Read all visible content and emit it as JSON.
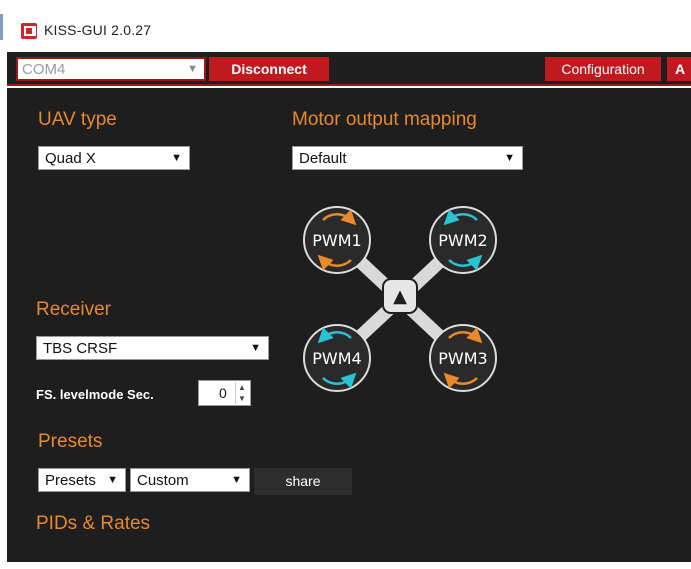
{
  "window": {
    "title": "KISS-GUI 2.0.27"
  },
  "toolbar": {
    "port": "COM4",
    "port_arrow": "▼",
    "disconnect_label": "Disconnect",
    "configuration_label": "Configuration",
    "more_tab_label": "A"
  },
  "uav": {
    "heading": "UAV type",
    "value": "Quad X"
  },
  "motor": {
    "heading": "Motor output mapping",
    "value": "Default",
    "diagram": {
      "front_symbol": "▲",
      "motors": [
        {
          "label": "PWM1",
          "rotation": "cw"
        },
        {
          "label": "PWM2",
          "rotation": "ccw"
        },
        {
          "label": "PWM4",
          "rotation": "ccw"
        },
        {
          "label": "PWM3",
          "rotation": "cw"
        }
      ]
    }
  },
  "receiver": {
    "heading": "Receiver",
    "value": "TBS CRSF"
  },
  "failsafe": {
    "label": "FS. levelmode Sec.",
    "value": "0",
    "up_symbol": "▲",
    "down_symbol": "▼"
  },
  "presets": {
    "heading": "Presets",
    "preset_value": "Presets",
    "custom_value": "Custom",
    "share_label": "share"
  },
  "pids": {
    "heading": "PIDs & Rates"
  },
  "colors": {
    "accent_orange": "#e8892b",
    "brand_red": "#c0191f",
    "panel_dark": "#1e1e1e",
    "cw_arrow": "#e8892b",
    "ccw_arrow": "#29c3d3"
  },
  "select_arrow": "▼"
}
